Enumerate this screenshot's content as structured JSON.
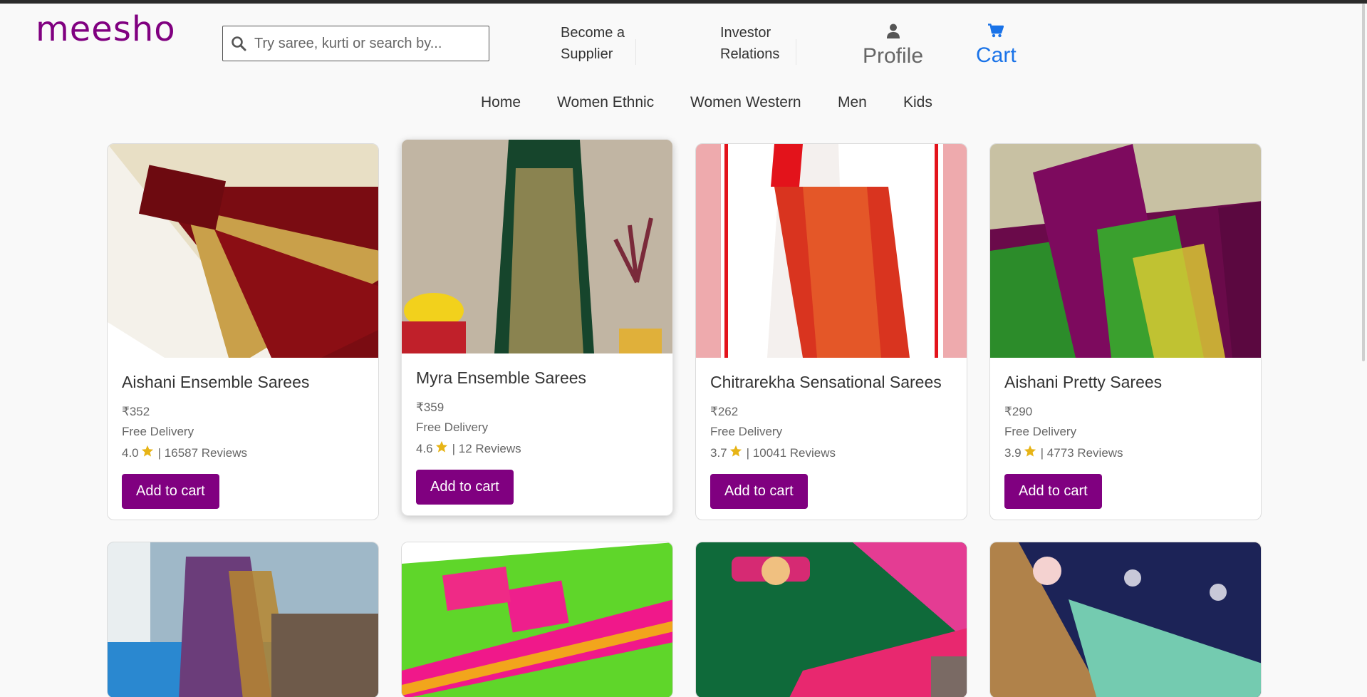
{
  "header": {
    "logo": "meesho",
    "search_placeholder": "Try saree, kurti or search by...",
    "become_supplier": [
      "Become a",
      "Supplier"
    ],
    "investor_relations": [
      "Investor",
      "Relations"
    ],
    "profile_label": "Profile",
    "cart_label": "Cart"
  },
  "nav": {
    "items": [
      "Home",
      "Women Ethnic",
      "Women Western",
      "Men",
      "Kids"
    ]
  },
  "products": [
    {
      "title": "Aishani Ensemble Sarees",
      "price": "₹352",
      "delivery": "Free Delivery",
      "rating": "4.0",
      "reviews": "| 16587 Reviews",
      "button": "Add to cart"
    },
    {
      "title": "Myra Ensemble Sarees",
      "price": "₹359",
      "delivery": "Free Delivery",
      "rating": "4.6",
      "reviews": "| 12 Reviews",
      "button": "Add to cart"
    },
    {
      "title": "Chitrarekha Sensational Sarees",
      "price": "₹262",
      "delivery": "Free Delivery",
      "rating": "3.7",
      "reviews": "| 10041 Reviews",
      "button": "Add to cart"
    },
    {
      "title": "Aishani Pretty Sarees",
      "price": "₹290",
      "delivery": "Free Delivery",
      "rating": "3.9",
      "reviews": "| 4773 Reviews",
      "button": "Add to cart"
    }
  ],
  "colors": {
    "brand": "#800080",
    "cart_blue": "#1a73e8",
    "star": "#e7b416"
  },
  "icons": {
    "search": "search-icon",
    "profile": "user-icon",
    "cart": "cart-icon",
    "rating": "star-icon"
  }
}
